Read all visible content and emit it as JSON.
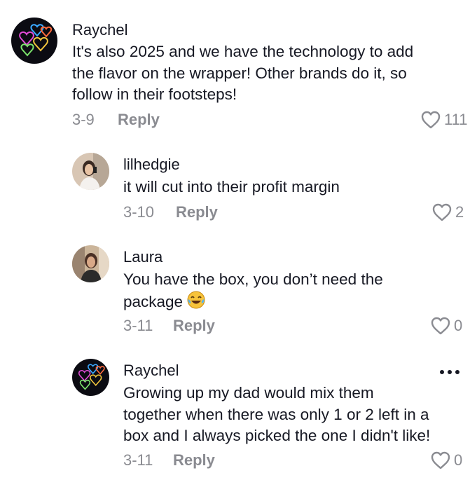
{
  "comments": [
    {
      "username": "Raychel",
      "text": "It's also 2025 and we have the technology to add\nthe flavor on the wrapper! Other brands do it, so\nfollow in their footsteps!",
      "date": "3-9",
      "reply_label": "Reply",
      "likes": "111",
      "avatar_icon": "rainbow-hearts-avatar"
    },
    {
      "username": "lilhedgie",
      "text": "it will cut into their profit margin",
      "date": "3-10",
      "reply_label": "Reply",
      "likes": "2",
      "avatar_icon": "photo-avatar"
    },
    {
      "username": "Laura",
      "text": "You have the box, you don’t need the\npackage",
      "date": "3-11",
      "reply_label": "Reply",
      "likes": "0",
      "avatar_icon": "photo-avatar",
      "emoji": "face-with-tears-of-joy"
    },
    {
      "username": "Raychel",
      "text": "Growing up my dad would mix them\ntogether when there was only 1 or 2 left in a\nbox and I always picked the one I didn't like!",
      "date": "3-11",
      "reply_label": "Reply",
      "likes": "0",
      "avatar_icon": "rainbow-hearts-avatar"
    }
  ],
  "colors": {
    "text": "#161823",
    "secondary": "#8a8b91",
    "background": "#ffffff"
  }
}
